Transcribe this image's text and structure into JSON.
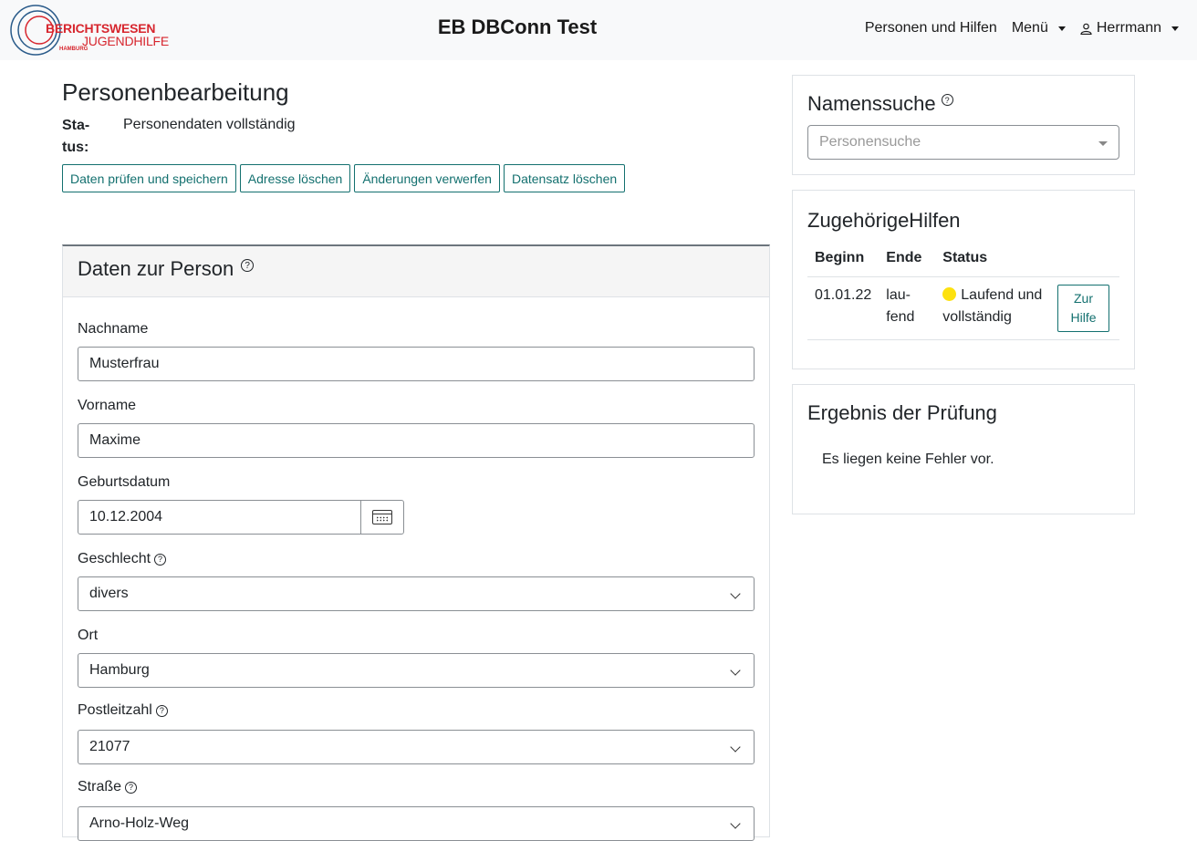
{
  "header": {
    "logo": {
      "line1": "BERICHTSWESEN",
      "line2": "JUGENDHILFE",
      "line3": "HAMBURG",
      "color": "#d7262e"
    },
    "app_title": "EB DBConn Test",
    "nav": {
      "personen": "Personen und Hilfen",
      "menu": "Menü",
      "user": "Herrmann"
    }
  },
  "page": {
    "title": "Personenbearbeitung",
    "status_label": "Sta-tus:",
    "status_value": "Personendaten vollständig",
    "buttons": {
      "save": "Daten prüfen und speichern",
      "delete_address": "Adresse löschen",
      "discard": "Änderungen verwerfen",
      "delete_record": "Datensatz löschen"
    },
    "accent_color": "#13706f"
  },
  "person_card": {
    "title": "Daten zur Person",
    "fields": {
      "nachname": {
        "label": "Nachname",
        "value": "Musterfrau"
      },
      "vorname": {
        "label": "Vorname",
        "value": "Maxime"
      },
      "geburtsdatum": {
        "label": "Geburtsdatum",
        "value": "10.12.2004"
      },
      "geschlecht": {
        "label": "Geschlecht",
        "value": "divers"
      },
      "ort": {
        "label": "Ort",
        "value": "Hamburg"
      },
      "plz": {
        "label": "Postleitzahl",
        "value": "21077"
      },
      "strasse": {
        "label": "Straße",
        "value": "Arno-Holz-Weg"
      }
    }
  },
  "sidebar": {
    "search": {
      "title": "Namenssuche",
      "placeholder": "Personensuche"
    },
    "hilfen": {
      "title": "ZugehörigeHilfen",
      "columns": [
        "Beginn",
        "Ende",
        "Status"
      ],
      "rows": [
        {
          "beginn": "01.01.22",
          "ende_1": "lau-",
          "ende_2": "fend",
          "status_1": "Laufend und",
          "status_2": "vollständig",
          "status_color": "#fde10f",
          "button_1": "Zur",
          "button_2": "Hilfe"
        }
      ]
    },
    "result": {
      "title": "Ergebnis der Prüfung",
      "text": "Es liegen keine Fehler vor."
    }
  }
}
